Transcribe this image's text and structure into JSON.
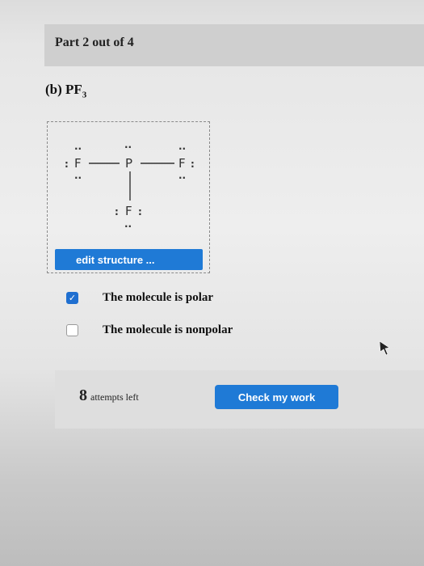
{
  "header": {
    "title": "Part 2 out of 4"
  },
  "question": {
    "label": "(b) PF",
    "subscript": "3"
  },
  "structure": {
    "atoms": {
      "center": "P",
      "left": "F",
      "right": "F",
      "bottom": "F"
    },
    "edit_button_label": "edit structure ..."
  },
  "options": [
    {
      "label": "The molecule is polar",
      "checked": true
    },
    {
      "label": "The molecule is nonpolar",
      "checked": false
    }
  ],
  "footer": {
    "attempts_count": "8",
    "attempts_text": "attempts left",
    "check_button_label": "Check my work"
  },
  "colors": {
    "accent": "#1f7ad6",
    "checkbox_checked": "#1f6fd0"
  }
}
